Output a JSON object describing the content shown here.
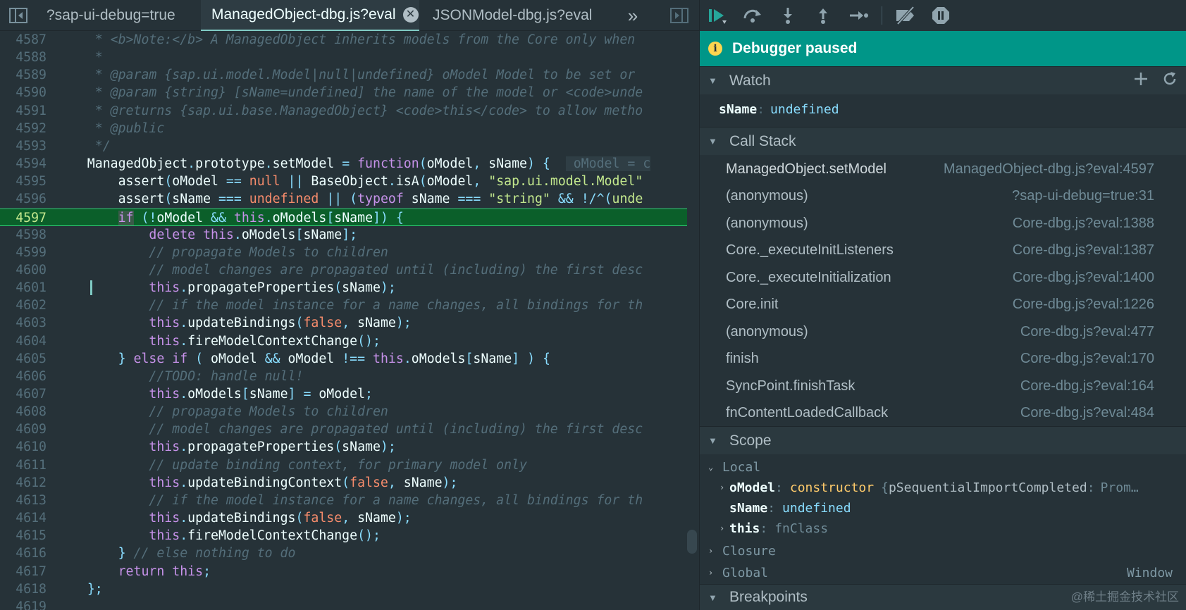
{
  "tabs": [
    {
      "label": "?sap-ui-debug=true",
      "active": false
    },
    {
      "label": "ManagedObject-dbg.js?eval",
      "active": true
    },
    {
      "label": "JSONModel-dbg.js?eval",
      "active": false
    }
  ],
  "editor": {
    "paused_line": "4597",
    "lines": [
      {
        "n": "4587",
        "html": "<span class=\"cm\">     * &lt;b&gt;Note:&lt;/b&gt; A ManagedObject inherits models from the Core only when </span>"
      },
      {
        "n": "4588",
        "html": "<span class=\"cm\">     *</span>"
      },
      {
        "n": "4589",
        "html": "<span class=\"cm\">     * @param {sap.ui.model.Model|null|undefined} oModel Model to be set or </span>"
      },
      {
        "n": "4590",
        "html": "<span class=\"cm\">     * @param {string} [sName=undefined] the name of the model or &lt;code&gt;unde</span>"
      },
      {
        "n": "4591",
        "html": "<span class=\"cm\">     * @returns {sap.ui.base.ManagedObject} &lt;code&gt;this&lt;/code&gt; to allow metho</span>"
      },
      {
        "n": "4592",
        "html": "<span class=\"cm\">     * @public</span>"
      },
      {
        "n": "4593",
        "html": "<span class=\"cm\">     */</span>"
      },
      {
        "n": "4594",
        "html": "    ManagedObject<span class=\"pn\">.</span>prototype<span class=\"pn\">.</span>setModel <span class=\"pn\">=</span> <span class=\"kw\">function</span><span class=\"pn\">(</span>oModel<span class=\"pn\">,</span> sName<span class=\"pn\">)</span> <span class=\"pn\">{</span>  <span class=\"inl\"> oModel = c</span>"
      },
      {
        "n": "4595",
        "html": "        assert<span class=\"pn\">(</span>oModel <span class=\"pn\">==</span> <span class=\"lit\">null</span> <span class=\"pn\">||</span> BaseObject<span class=\"pn\">.</span>isA<span class=\"pn\">(</span>oModel<span class=\"pn\">,</span> <span class=\"str\">\"sap.ui.model.Model\"</span>"
      },
      {
        "n": "4596",
        "html": "        assert<span class=\"pn\">(</span>sName <span class=\"pn\">===</span> <span class=\"lit\">undefined</span> <span class=\"pn\">||</span> <span class=\"pn\">(</span><span class=\"kw\">typeof</span> sName <span class=\"pn\">===</span> <span class=\"str\">\"string\"</span> <span class=\"pn\">&amp;&amp;</span> <span class=\"pn\">!/^(</span><span class=\"str\">unde</span>"
      },
      {
        "n": "4597",
        "html": "        <span class=\"kw hl\">if</span> <span class=\"pn\">(!</span>oModel <span class=\"pn\">&amp;&amp;</span> <span class=\"kw\">this</span><span class=\"pn\">.</span>oModels<span class=\"pn\">[</span>sName<span class=\"pn\">])</span> <span class=\"pn\">{</span>"
      },
      {
        "n": "4598",
        "html": "            <span class=\"kw\">delete</span> <span class=\"kw\">this</span><span class=\"pn\">.</span>oModels<span class=\"pn\">[</span>sName<span class=\"pn\">];</span>"
      },
      {
        "n": "4599",
        "html": "<span class=\"cm\">            // propagate Models to children</span>"
      },
      {
        "n": "4600",
        "html": "<span class=\"cm\">            // model changes are propagated until (including) the first desc</span>"
      },
      {
        "n": "4601",
        "html": "            <span class=\"kw\">this</span><span class=\"pn\">.</span>propagateProperties<span class=\"pn\">(</span>sName<span class=\"pn\">);</span>"
      },
      {
        "n": "4602",
        "html": "<span class=\"cm\">            // if the model instance for a name changes, all bindings for th</span>"
      },
      {
        "n": "4603",
        "html": "            <span class=\"kw\">this</span><span class=\"pn\">.</span>updateBindings<span class=\"pn\">(</span><span class=\"lit\">false</span><span class=\"pn\">,</span> sName<span class=\"pn\">);</span>"
      },
      {
        "n": "4604",
        "html": "            <span class=\"kw\">this</span><span class=\"pn\">.</span>fireModelContextChange<span class=\"pn\">();</span>"
      },
      {
        "n": "4605",
        "html": "        <span class=\"pn\">}</span> <span class=\"kw\">else</span> <span class=\"kw\">if</span> <span class=\"pn\">(</span> oModel <span class=\"pn\">&amp;&amp;</span> oModel <span class=\"pn\">!==</span> <span class=\"kw\">this</span><span class=\"pn\">.</span>oModels<span class=\"pn\">[</span>sName<span class=\"pn\">]</span> <span class=\"pn\">)</span> <span class=\"pn\">{</span>"
      },
      {
        "n": "4606",
        "html": "<span class=\"cm\">            //TODO: handle null!</span>"
      },
      {
        "n": "4607",
        "html": "            <span class=\"kw\">this</span><span class=\"pn\">.</span>oModels<span class=\"pn\">[</span>sName<span class=\"pn\">]</span> <span class=\"pn\">=</span> oModel<span class=\"pn\">;</span>"
      },
      {
        "n": "4608",
        "html": "<span class=\"cm\">            // propagate Models to children</span>"
      },
      {
        "n": "4609",
        "html": "<span class=\"cm\">            // model changes are propagated until (including) the first desc</span>"
      },
      {
        "n": "4610",
        "html": "            <span class=\"kw\">this</span><span class=\"pn\">.</span>propagateProperties<span class=\"pn\">(</span>sName<span class=\"pn\">);</span>"
      },
      {
        "n": "4611",
        "html": "<span class=\"cm\">            // update binding context, for primary model only</span>"
      },
      {
        "n": "4612",
        "html": "            <span class=\"kw\">this</span><span class=\"pn\">.</span>updateBindingContext<span class=\"pn\">(</span><span class=\"lit\">false</span><span class=\"pn\">,</span> sName<span class=\"pn\">);</span>"
      },
      {
        "n": "4613",
        "html": "<span class=\"cm\">            // if the model instance for a name changes, all bindings for th</span>"
      },
      {
        "n": "4614",
        "html": "            <span class=\"kw\">this</span><span class=\"pn\">.</span>updateBindings<span class=\"pn\">(</span><span class=\"lit\">false</span><span class=\"pn\">,</span> sName<span class=\"pn\">);</span>"
      },
      {
        "n": "4615",
        "html": "            <span class=\"kw\">this</span><span class=\"pn\">.</span>fireModelContextChange<span class=\"pn\">();</span>"
      },
      {
        "n": "4616",
        "html": "        <span class=\"pn\">}</span> <span class=\"cm\">// else nothing to do</span>"
      },
      {
        "n": "4617",
        "html": "        <span class=\"kw\">return</span> <span class=\"kw\">this</span><span class=\"pn\">;</span>"
      },
      {
        "n": "4618",
        "html": "    <span class=\"pn\">};</span>"
      },
      {
        "n": "4619",
        "html": ""
      }
    ]
  },
  "debugger": {
    "status": "Debugger paused",
    "sections": {
      "watch": "Watch",
      "call_stack": "Call Stack",
      "scope": "Scope",
      "breakpoints": "Breakpoints"
    },
    "watch": [
      {
        "name": "sName",
        "value": "undefined"
      }
    ],
    "call_stack": [
      {
        "name": "ManagedObject.setModel",
        "location": "ManagedObject-dbg.js?eval:4597",
        "current": true
      },
      {
        "name": "(anonymous)",
        "location": "?sap-ui-debug=true:31"
      },
      {
        "name": "(anonymous)",
        "location": "Core-dbg.js?eval:1388"
      },
      {
        "name": "Core._executeInitListeners",
        "location": "Core-dbg.js?eval:1387"
      },
      {
        "name": "Core._executeInitialization",
        "location": "Core-dbg.js?eval:1400"
      },
      {
        "name": "Core.init",
        "location": "Core-dbg.js?eval:1226"
      },
      {
        "name": "(anonymous)",
        "location": "Core-dbg.js?eval:477"
      },
      {
        "name": "finish",
        "location": "Core-dbg.js?eval:170"
      },
      {
        "name": "SyncPoint.finishTask",
        "location": "Core-dbg.js?eval:164"
      },
      {
        "name": "fnContentLoadedCallback",
        "location": "Core-dbg.js?eval:484"
      }
    ],
    "scope": {
      "local_label": "Local",
      "local_vars": [
        {
          "name": "oModel",
          "type": "constructor",
          "preview_key": "pSequentialImportCompleted",
          "preview_val": "Prom…",
          "expandable": true
        },
        {
          "name": "sName",
          "value": "undefined",
          "expandable": false
        },
        {
          "name": "this",
          "value": "fnClass",
          "expandable": true
        }
      ],
      "closure_label": "Closure",
      "global_label": "Global",
      "global_value": "Window"
    }
  },
  "watermark": "@稀土掘金技术社区",
  "colors": {
    "accent": "#009688",
    "paused_line": "#0b5f2a",
    "editor_bg": "#263238"
  }
}
